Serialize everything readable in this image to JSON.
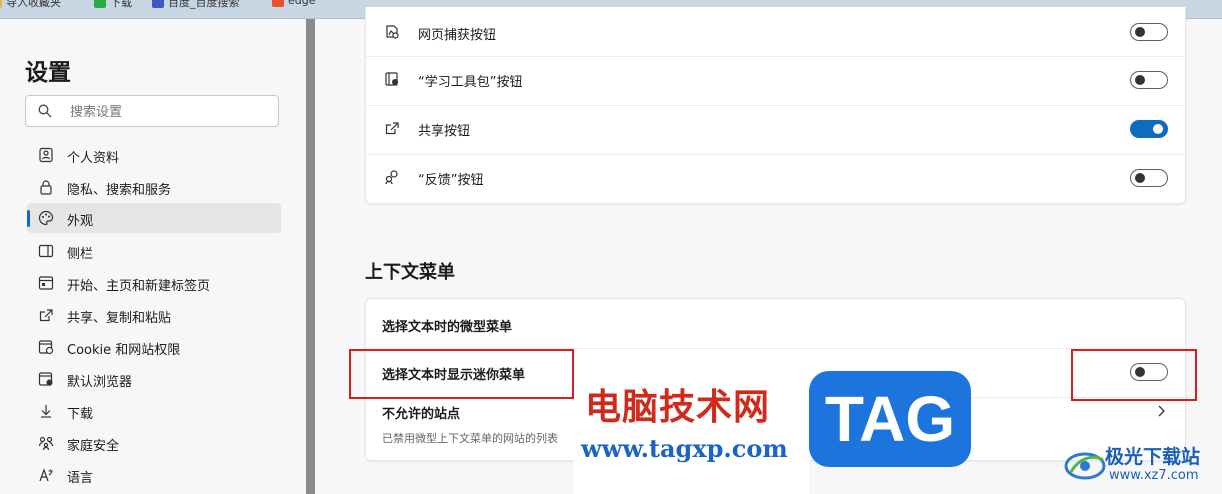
{
  "bookmarks": [
    {
      "label": "导入收藏夹",
      "icon": "folder-icon"
    },
    {
      "label": "下载",
      "icon": "download-bookmark-icon"
    },
    {
      "label": "百度_百度搜索",
      "icon": "baidu-icon"
    },
    {
      "label": "edge",
      "icon": "c-brand-icon"
    }
  ],
  "sidebar": {
    "title": "设置",
    "search_placeholder": "搜索设置",
    "items": [
      {
        "label": "个人资料",
        "icon": "profile-icon",
        "active": false
      },
      {
        "label": "隐私、搜索和服务",
        "icon": "lock-icon",
        "active": false
      },
      {
        "label": "外观",
        "icon": "palette-icon",
        "active": true
      },
      {
        "label": "侧栏",
        "icon": "sidebar-icon",
        "active": false
      },
      {
        "label": "开始、主页和新建标签页",
        "icon": "home-tab-icon",
        "active": false
      },
      {
        "label": "共享、复制和粘贴",
        "icon": "share-icon",
        "active": false
      },
      {
        "label": "Cookie 和网站权限",
        "icon": "site-permissions-icon",
        "active": false
      },
      {
        "label": "默认浏览器",
        "icon": "browser-icon",
        "active": false
      },
      {
        "label": "下载",
        "icon": "download-icon",
        "active": false
      },
      {
        "label": "家庭安全",
        "icon": "family-icon",
        "active": false
      },
      {
        "label": "语言",
        "icon": "language-icon",
        "active": false
      }
    ]
  },
  "toolbar_buttons": [
    {
      "label": "网页捕获按钮",
      "icon": "web-capture-icon",
      "on": false
    },
    {
      "label": "“学习工具包”按钮",
      "icon": "learning-toolkit-icon",
      "on": false
    },
    {
      "label": "共享按钮",
      "icon": "share-icon",
      "on": true
    },
    {
      "label": "“反馈”按钮",
      "icon": "feedback-icon",
      "on": false
    }
  ],
  "context_menu": {
    "title": "上下文菜单",
    "mini_menu_heading": "选择文本时的微型菜单",
    "show_mini_menu_label": "选择文本时显示迷你菜单",
    "show_mini_menu_on": false,
    "blocked_sites_label": "不允许的站点",
    "blocked_sites_desc": "已禁用微型上下文菜单的网站的列表"
  },
  "watermark": {
    "cn_text": "电脑技术网",
    "url": "www.tagxp.com",
    "tag": "TAG",
    "site_name": "极光下载站",
    "site_url": "www.xz7.com"
  },
  "colors": {
    "accent": "#0f6cbd",
    "highlight_box": "#d32020",
    "watermark_red": "#d12a1c",
    "watermark_blue": "#1d74dc"
  }
}
